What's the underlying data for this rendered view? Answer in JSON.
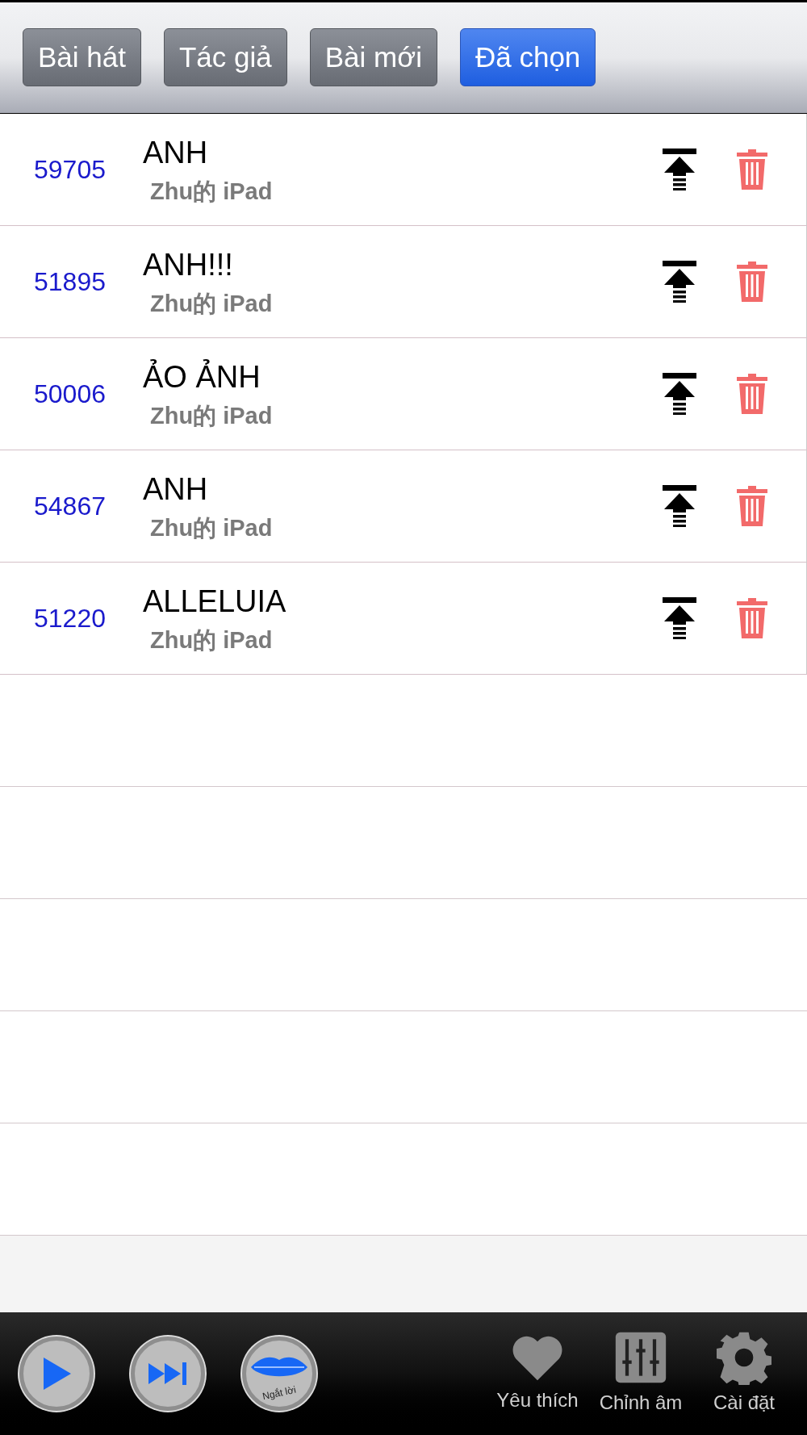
{
  "tabs": [
    {
      "label": "Bài hát",
      "selected": false
    },
    {
      "label": "Tác giả",
      "selected": false
    },
    {
      "label": "Bài mới",
      "selected": false
    },
    {
      "label": "Đã chọn",
      "selected": true
    }
  ],
  "songs": [
    {
      "number": "59705",
      "title": "ANH",
      "device": "Zhu的 iPad"
    },
    {
      "number": "51895",
      "title": "ANH!!!",
      "device": "Zhu的 iPad"
    },
    {
      "number": "50006",
      "title": "ẢO ẢNH",
      "device": "Zhu的 iPad"
    },
    {
      "number": "54867",
      "title": "ANH",
      "device": "Zhu的 iPad"
    },
    {
      "number": "51220",
      "title": "ALLELUIA",
      "device": "Zhu的 iPad"
    }
  ],
  "player": {
    "mute_label": "Ngắt lời"
  },
  "toolbar": [
    {
      "label": "Yêu thích",
      "kind": "heart"
    },
    {
      "label": "Chỉnh âm",
      "kind": "mixer"
    },
    {
      "label": "Cài đặt",
      "kind": "gear"
    }
  ]
}
